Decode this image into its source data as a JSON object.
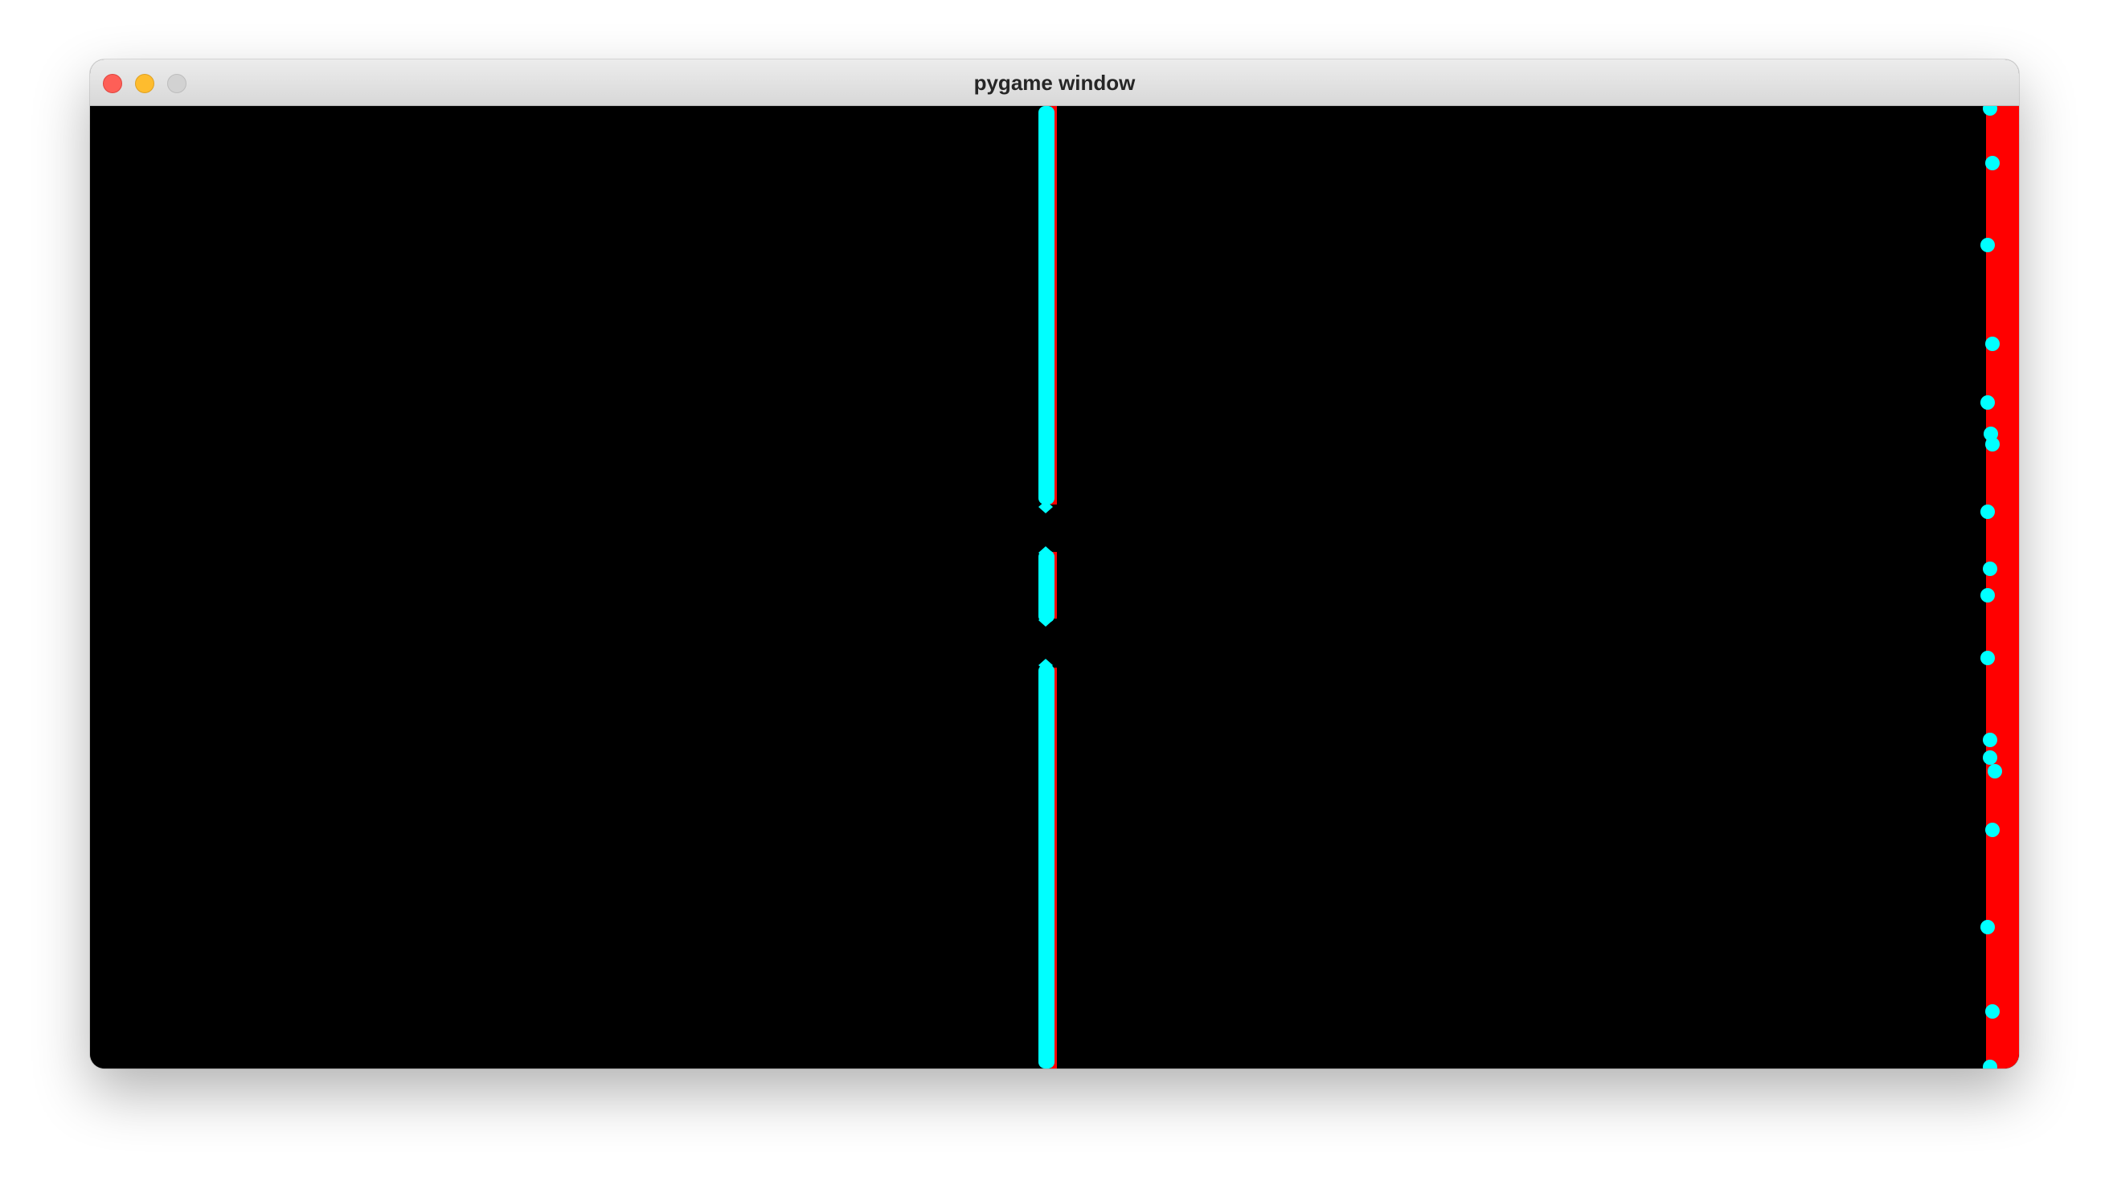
{
  "window": {
    "title": "pygame window",
    "controls": [
      "close",
      "minimize",
      "zoom"
    ]
  },
  "game": {
    "background_color": "#000000",
    "wall_color": "#ff0000",
    "ball_color": "#00ffff"
  }
}
